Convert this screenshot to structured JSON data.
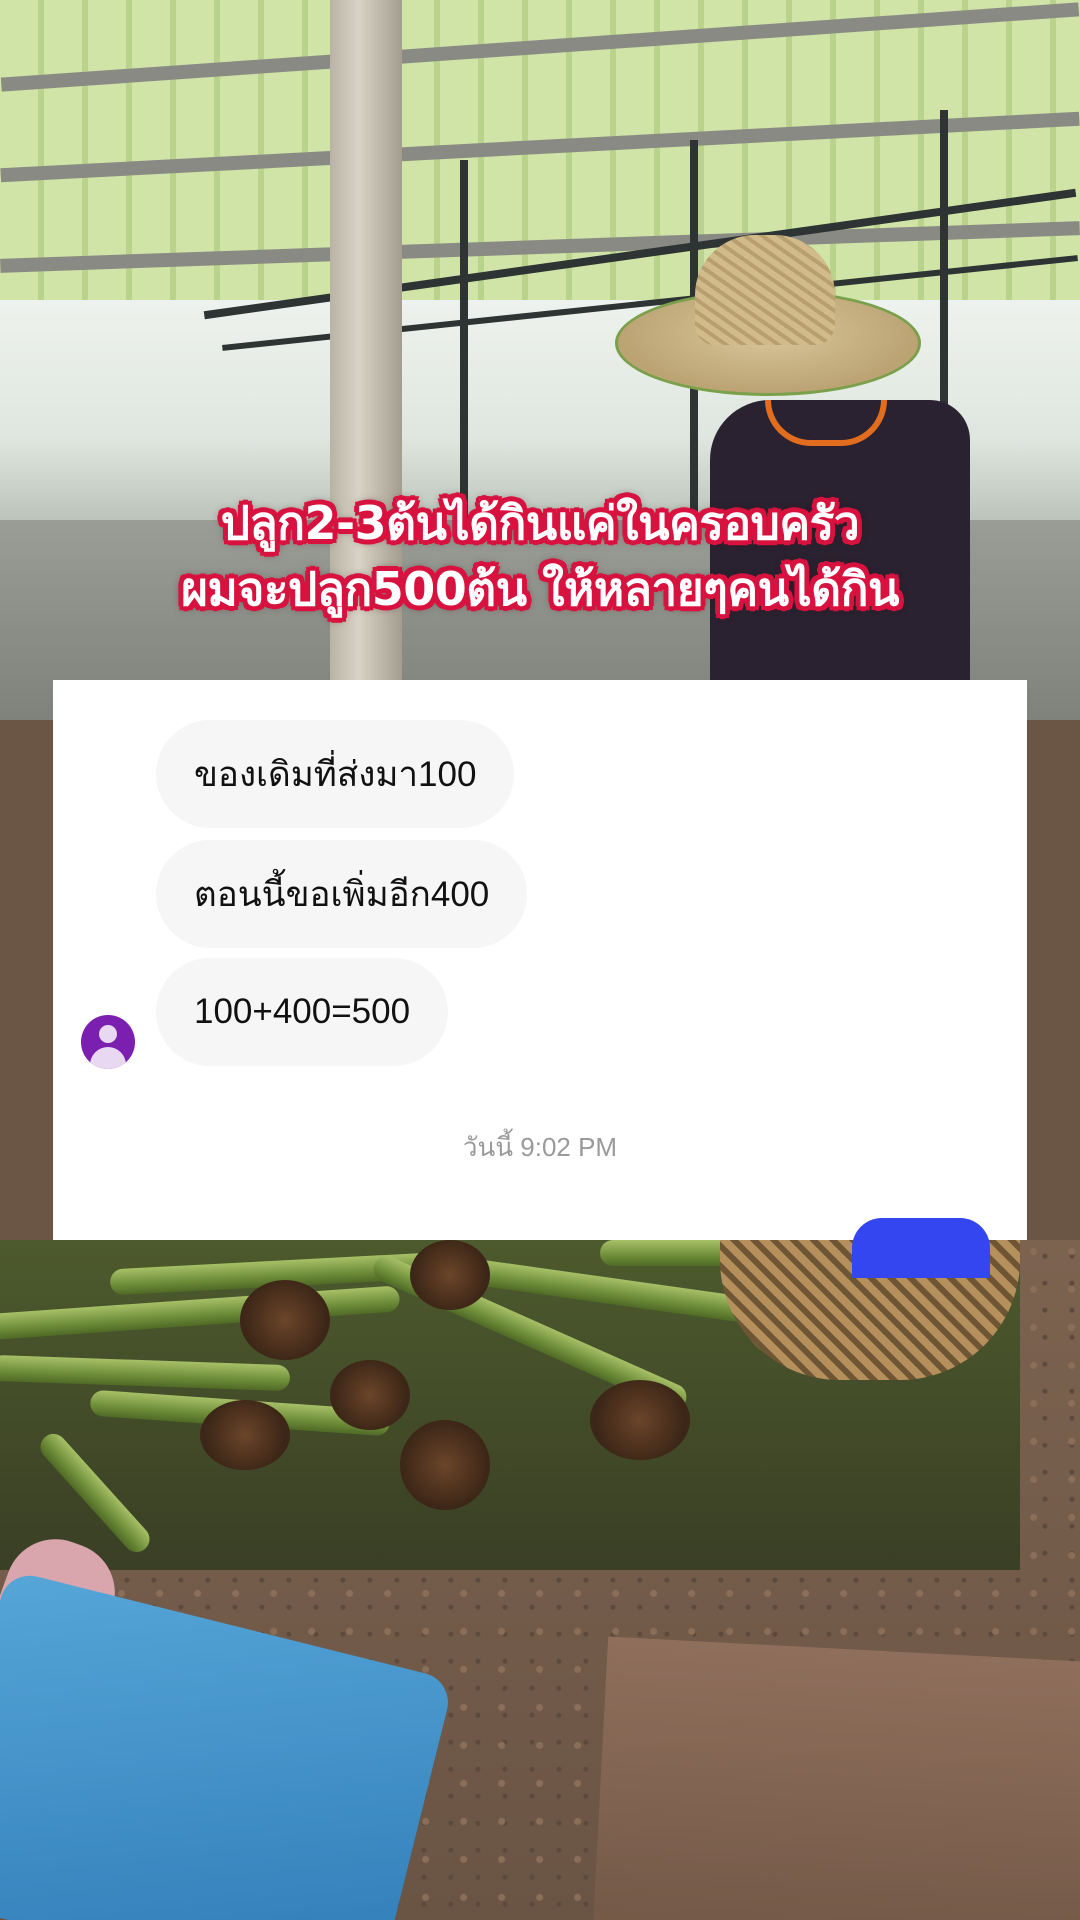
{
  "caption": {
    "line1": "ปลูก2-3ต้นได้กินแค่ในครอบครัว",
    "line2": "ผมจะปลูก500ต้น ให้หลายๆคนได้กิน"
  },
  "chat": {
    "messages": [
      "ของเดิมที่ส่งมา100",
      "ตอนนี้ขอเพิ่มอีก400",
      "100+400=500"
    ],
    "timestamp": "วันนี้ 9:02 PM"
  },
  "colors": {
    "caption_outline": "#d8123f",
    "bubble_bg": "#f6f6f6",
    "avatar": "#7a1fb0",
    "accent_blue": "#3346f0"
  }
}
